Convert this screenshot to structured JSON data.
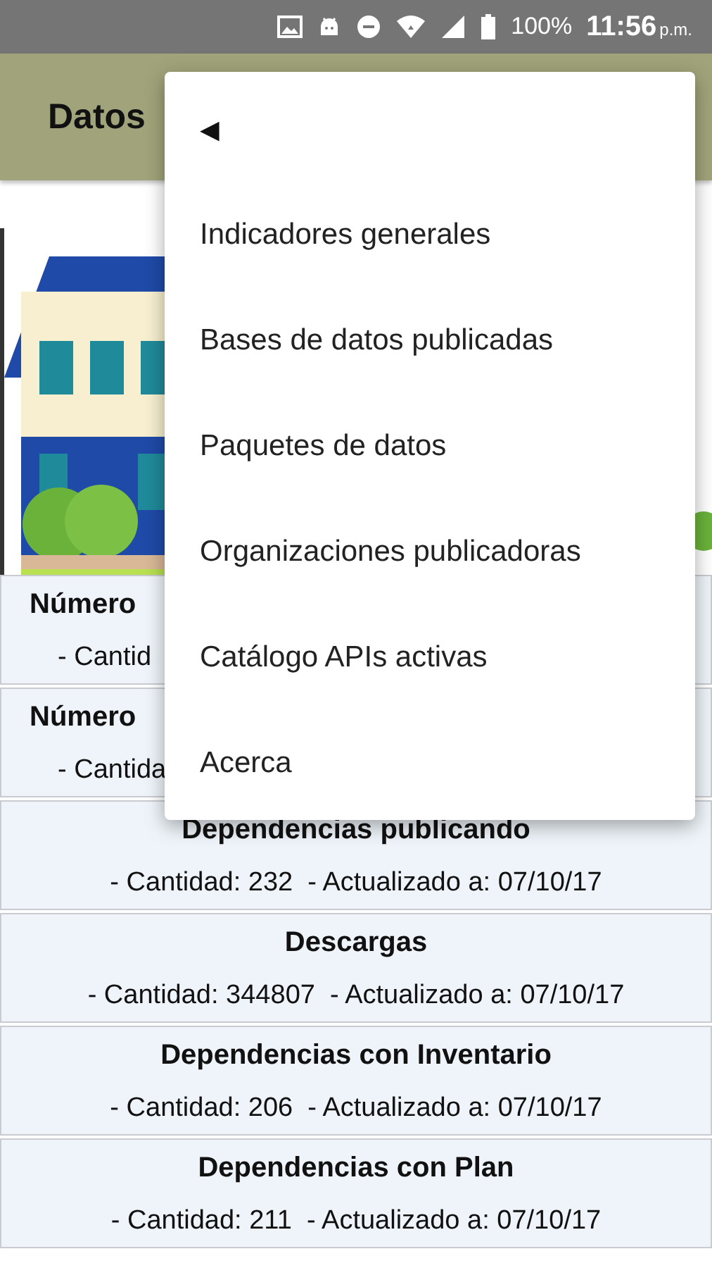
{
  "status_bar": {
    "battery": "100%",
    "time": "11:56",
    "period": "p.m."
  },
  "app_bar": {
    "title": "Datos"
  },
  "cards": [
    {
      "kind": "covered",
      "title": "Número",
      "detail": "- Cantid"
    },
    {
      "kind": "covered",
      "title": "Número",
      "detail": "- Cantida"
    },
    {
      "kind": "full",
      "title": "Dependencias publicando",
      "detail": "- Cantidad: 232  - Actualizado a: 07/10/17"
    },
    {
      "kind": "full",
      "title": "Descargas",
      "detail": "- Cantidad: 344807  - Actualizado a: 07/10/17"
    },
    {
      "kind": "full",
      "title": "Dependencias con Inventario",
      "detail": "- Cantidad: 206  - Actualizado a: 07/10/17"
    },
    {
      "kind": "full",
      "title": "Dependencias con Plan",
      "detail": "- Cantidad: 211  - Actualizado a: 07/10/17"
    }
  ],
  "menu": {
    "back": "◀",
    "items": [
      "Indicadores generales",
      "Bases de datos publicadas",
      "Paquetes de datos",
      "Organizaciones publicadoras",
      "Catálogo APIs activas",
      "Acerca"
    ]
  }
}
